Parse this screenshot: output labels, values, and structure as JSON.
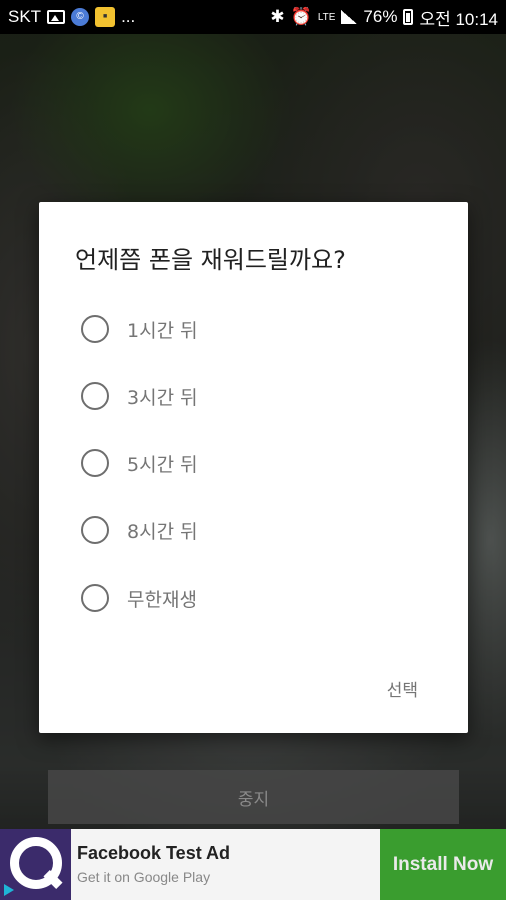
{
  "status_bar": {
    "carrier": "SKT",
    "more": "...",
    "network": "LTE",
    "battery": "76%",
    "time": "오전 10:14"
  },
  "dialog": {
    "title": "언제쯤 폰을 재워드릴까요?",
    "options": [
      {
        "label": "1시간 뒤",
        "selected": false
      },
      {
        "label": "3시간 뒤",
        "selected": false
      },
      {
        "label": "5시간 뒤",
        "selected": false
      },
      {
        "label": "8시간 뒤",
        "selected": false
      },
      {
        "label": "무한재생",
        "selected": false
      }
    ],
    "action_label": "선택"
  },
  "stop_button": {
    "label": "중지"
  },
  "ad": {
    "title": "Facebook Test Ad",
    "subtitle": "Get it on Google Play",
    "install_label": "Install Now"
  },
  "colors": {
    "status_bar_bg": "#000000",
    "dialog_bg": "#ffffff",
    "ad_install_bg": "#3a9d2f",
    "ad_logo_bg": "#3b2b6b"
  }
}
